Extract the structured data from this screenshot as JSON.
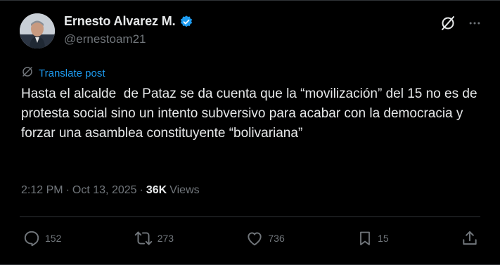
{
  "author": {
    "display_name": "Ernesto Alvarez M.",
    "handle": "@ernestoam21",
    "verified": true
  },
  "translate": {
    "label": "Translate post"
  },
  "post": {
    "text": "Hasta el alcalde  de Pataz se da cuenta que la “movilización” del 15 no es de protesta social sino un intento subversivo para acabar con la democracia y forzar una asamblea constituyente “bolivariana”"
  },
  "meta": {
    "time": "2:12 PM",
    "separator": "·",
    "date": "Oct 13, 2025",
    "views_count": "36K",
    "views_label": "Views"
  },
  "actions": {
    "replies": "152",
    "reposts": "273",
    "likes": "736",
    "bookmarks": "15"
  },
  "colors": {
    "background": "#000000",
    "text": "#e7e9ea",
    "muted": "#71767b",
    "accent": "#1d9bf0",
    "divider": "#2f3336"
  },
  "icons": {
    "top_right": [
      "grok-icon",
      "more-icon"
    ],
    "actions": [
      "reply-icon",
      "repost-icon",
      "like-icon",
      "bookmark-icon",
      "share-icon"
    ]
  }
}
